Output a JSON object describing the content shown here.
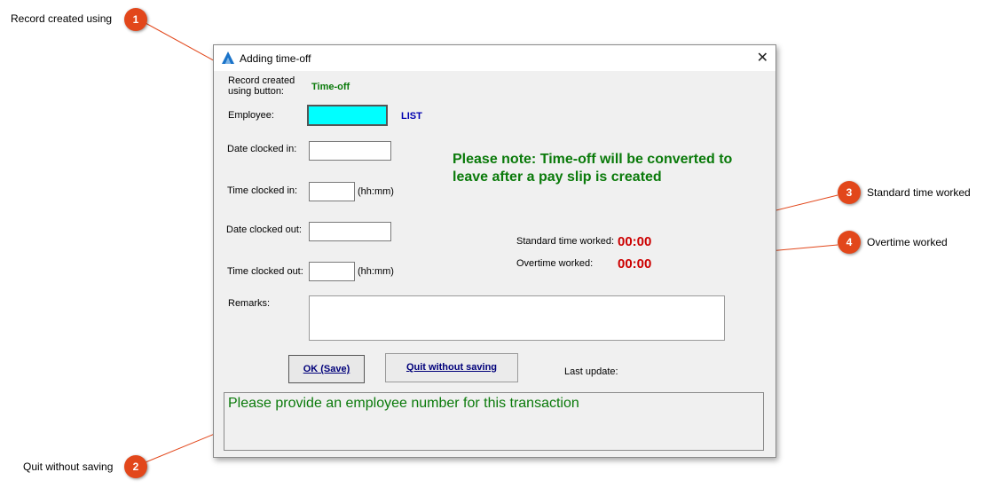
{
  "callouts": [
    {
      "num": "1",
      "label": "Record created using"
    },
    {
      "num": "2",
      "label": "Quit without saving"
    },
    {
      "num": "3",
      "label": "Standard time worked"
    },
    {
      "num": "4",
      "label": "Overtime worked"
    }
  ],
  "window": {
    "title": "Adding time-off",
    "close_symbol": "✕"
  },
  "form": {
    "record_created_label_line1": "Record created",
    "record_created_label_line2": "using button:",
    "record_created_value": "Time-off",
    "employee_label": "Employee:",
    "employee_value": "",
    "list_link": "LIST",
    "date_in_label": "Date clocked in:",
    "time_in_label": "Time clocked in:",
    "time_in_hint": "(hh:mm)",
    "date_out_label": "Date clocked out:",
    "time_out_label": "Time clocked out:",
    "time_out_hint": "(hh:mm)",
    "remarks_label": "Remarks:",
    "note_line1": "Please note: Time-off will be converted to",
    "note_line2": "leave after a pay slip is created",
    "standard_label": "Standard time worked:",
    "standard_value": "00:00",
    "overtime_label": "Overtime worked:",
    "overtime_value": "00:00",
    "last_update_label": "Last update:"
  },
  "buttons": {
    "ok": "OK (Save)",
    "quit": "Quit without saving"
  },
  "status_message": "Please provide an employee number for this transaction",
  "colors": {
    "badge": "#e2471b",
    "callout_line": "#e2471b",
    "note_green": "#0a7a0a",
    "time_red": "#cc0000",
    "employee_field": "#00ffff",
    "link_blue": "#0000b0"
  }
}
